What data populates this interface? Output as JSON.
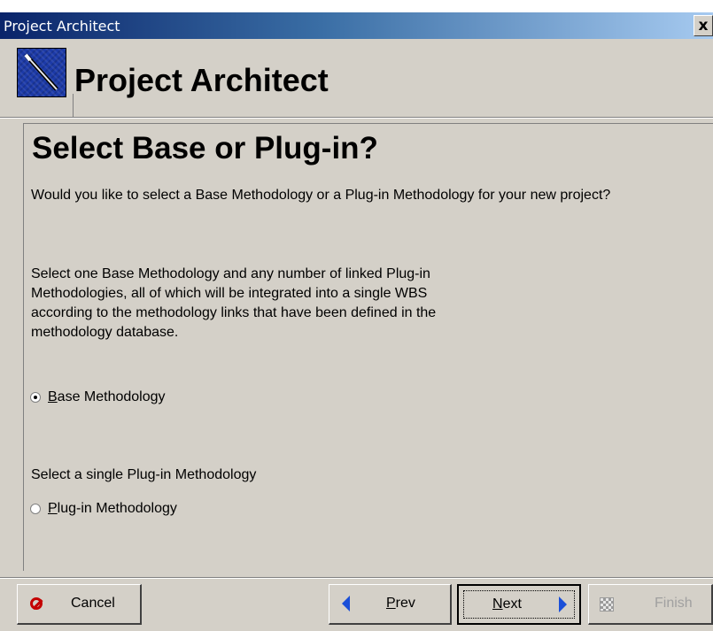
{
  "window": {
    "title": "Project Architect",
    "close_glyph": "x"
  },
  "header": {
    "logo_icon": "wand-icon",
    "title": "Project Architect"
  },
  "main": {
    "heading": "Select Base or Plug-in?",
    "question": "Would you like to select a Base Methodology or a Plug-in Methodology for your new project?",
    "base_description": "Select one Base Methodology and any number of linked Plug-in Methodologies, all of which will be integrated into a single WBS according to the methodology links that have been defined in the methodology database.",
    "base_option": {
      "accel": "B",
      "rest": "ase Methodology",
      "selected": true
    },
    "plugin_description": "Select a single Plug-in Methodology",
    "plugin_option": {
      "accel": "P",
      "rest": "lug-in Methodology",
      "selected": false
    }
  },
  "footer": {
    "cancel_label": "Cancel",
    "prev": {
      "accel": "P",
      "rest": "rev"
    },
    "next": {
      "accel": "N",
      "rest": "ext"
    },
    "finish_label": "Finish"
  },
  "colors": {
    "titlebar_start": "#0a246a",
    "titlebar_end": "#a6caf0",
    "dialog_bg": "#d4d0c8",
    "nav_arrow": "#1a4fd8",
    "cancel_icon": "#c40000"
  }
}
